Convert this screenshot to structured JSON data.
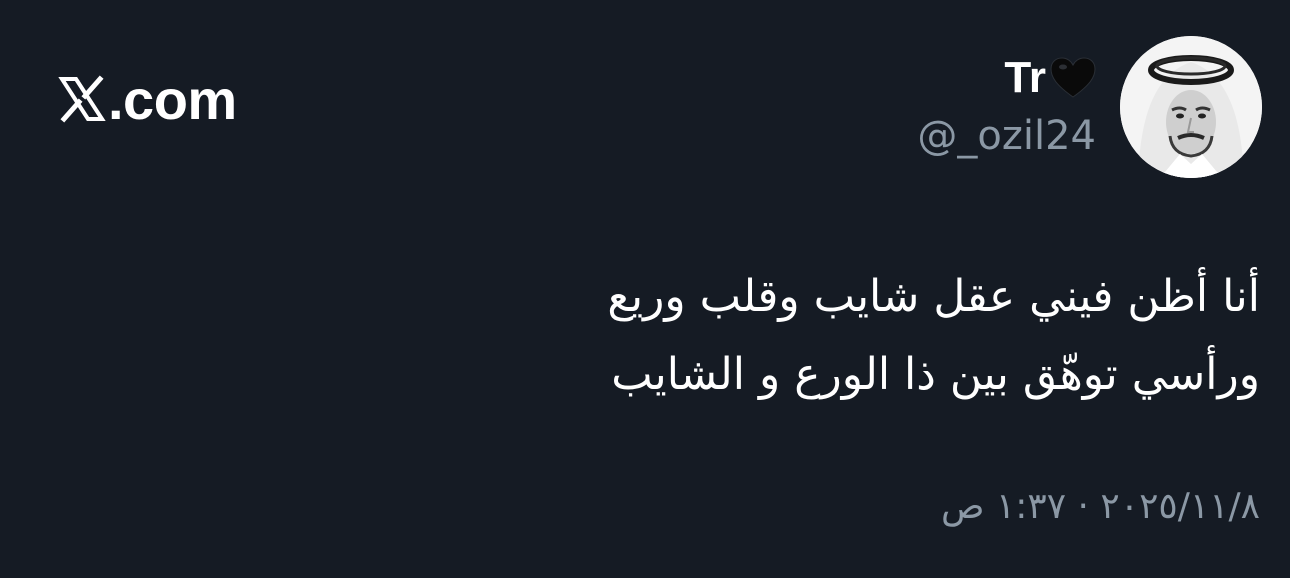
{
  "brand": {
    "logo_icon": "x-logo-icon",
    "domain_suffix": ".com"
  },
  "author": {
    "display_name": "Tr",
    "name_emoji": "black-heart-icon",
    "handle": "@_ozil24",
    "avatar_icon": "avatar-photo"
  },
  "tweet": {
    "lines": [
      "أنا أظن فيني عقل شايب وقلب وريع",
      "ورأسي توهّق بين ذا الورع و الشايب"
    ],
    "timestamp": "٢٠٢٥/١١/٨ · ١:٣٧ ص"
  },
  "colors": {
    "background": "#151b24",
    "primary_text": "#ffffff",
    "secondary_text": "#8b98a5"
  }
}
